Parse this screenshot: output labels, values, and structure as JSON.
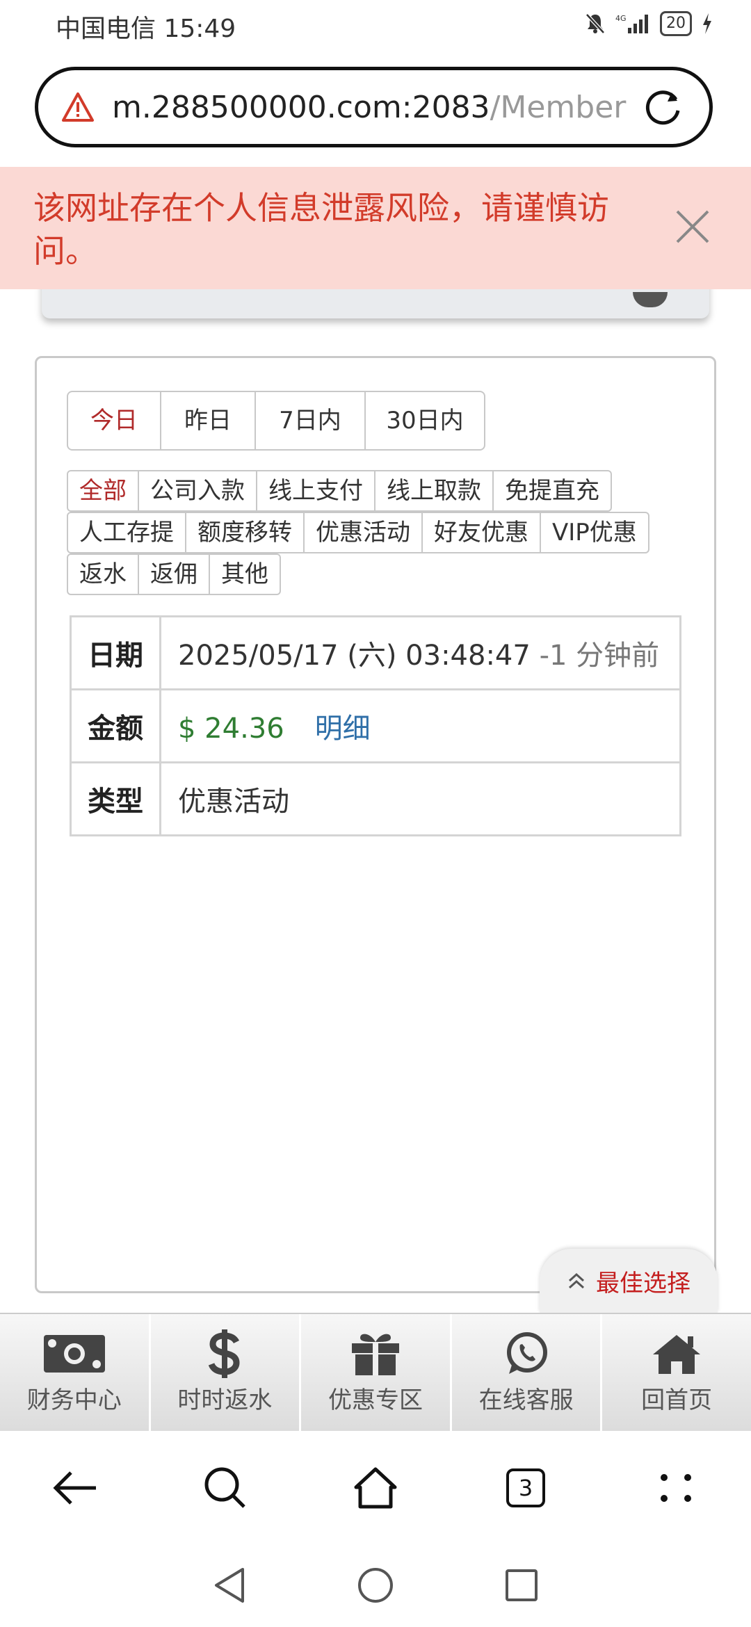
{
  "status_bar": {
    "carrier_time": "中国电信 15:49",
    "battery": "20"
  },
  "url_bar": {
    "url_main": "m.288500000.com:2083",
    "url_faded": "/MemberC"
  },
  "risk_banner": {
    "message": "该网址存在个人信息泄露风险，请谨慎访问。"
  },
  "date_tabs": [
    {
      "label": "今日",
      "active": true
    },
    {
      "label": "昨日",
      "active": false
    },
    {
      "label": "7日内",
      "active": false
    },
    {
      "label": "30日内",
      "active": false
    }
  ],
  "type_tabs": {
    "row1": [
      "全部",
      "公司入款",
      "线上支付",
      "线上取款",
      "免提直充"
    ],
    "row2": [
      "人工存提",
      "额度移转",
      "优惠活动",
      "好友优惠",
      "VIP优惠"
    ],
    "row3": [
      "返水",
      "返佣",
      "其他"
    ]
  },
  "record": {
    "date_label": "日期",
    "date_value": "2025/05/17 (六) 03:48:47",
    "date_ago": "-1 分钟前",
    "amount_label": "金额",
    "amount_value": "$ 24.36",
    "detail_link": "明细",
    "type_label": "类型",
    "type_value": "优惠活动"
  },
  "best_choice": {
    "label": "最佳选择"
  },
  "site_nav": [
    {
      "label": "财务中心",
      "icon": "money-icon"
    },
    {
      "label": "时时返水",
      "icon": "dollar-icon"
    },
    {
      "label": "优惠专区",
      "icon": "gift-icon"
    },
    {
      "label": "在线客服",
      "icon": "whatsapp-icon"
    },
    {
      "label": "回首页",
      "icon": "home-icon"
    }
  ],
  "browser_nav": {
    "tab_count": "3"
  },
  "colors": {
    "active": "#b02a2a",
    "amount": "#2f7d32",
    "link": "#2f6fa8",
    "risk": "#d23b2a",
    "risk_bg": "#fbd9d4"
  }
}
